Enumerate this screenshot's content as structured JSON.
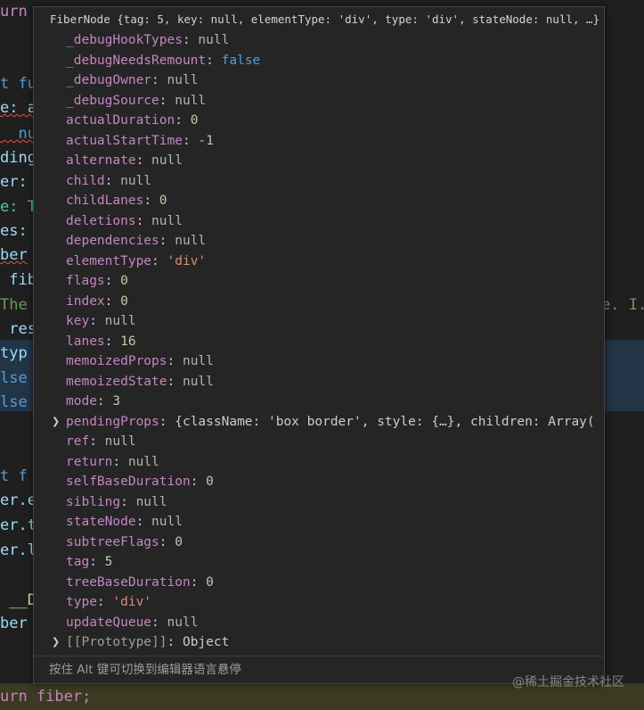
{
  "editor": {
    "lines": [
      {
        "text": "urn",
        "color": "#c586c0"
      },
      {
        "text": "t fu",
        "color": "#569cd6"
      },
      {
        "text": "e: a",
        "color": "#9cdcfe"
      },
      {
        "text": "  nu",
        "color": "#569cd6"
      },
      {
        "text": "ding",
        "color": "#9cdcfe"
      },
      {
        "text": "er:",
        "color": "#9cdcfe"
      },
      {
        "text": "e: T",
        "color": "#4ec9b0"
      },
      {
        "text": "es:",
        "color": "#9cdcfe"
      },
      {
        "text": "ber",
        "color": "#9cdcfe"
      },
      {
        "text": " fib",
        "color": "#9cdcfe"
      },
      {
        "text": "The",
        "color": "#6a9955"
      },
      {
        "text": " res",
        "color": "#9cdcfe"
      },
      {
        "text": "typ",
        "color": "#9cdcfe"
      },
      {
        "text": "lse",
        "color": "#569cd6"
      },
      {
        "text": "lse",
        "color": "#569cd6"
      },
      {
        "text": "t f",
        "color": "#569cd6"
      },
      {
        "text": "er.e",
        "color": "#9cdcfe"
      },
      {
        "text": "er.t",
        "color": "#9cdcfe"
      },
      {
        "text": "er.l",
        "color": "#9cdcfe"
      },
      {
        "text": " __D",
        "color": "#dcdcaa"
      },
      {
        "text": "ber",
        "color": "#9cdcfe"
      },
      {
        "text": "urn fiber;",
        "color": "#c586c0"
      }
    ],
    "right_fragment": "e. I."
  },
  "hover": {
    "title": "FiberNode {tag: 5, key: null, elementType: 'div', type: 'div', stateNode: null, …}",
    "properties": [
      {
        "key": "_debugHookTypes",
        "value": "null",
        "kind": "null"
      },
      {
        "key": "_debugNeedsRemount",
        "value": "false",
        "kind": "bool"
      },
      {
        "key": "_debugOwner",
        "value": "null",
        "kind": "null"
      },
      {
        "key": "_debugSource",
        "value": "null",
        "kind": "null"
      },
      {
        "key": "actualDuration",
        "value": "0",
        "kind": "num"
      },
      {
        "key": "actualStartTime",
        "value": "-1",
        "kind": "num"
      },
      {
        "key": "alternate",
        "value": "null",
        "kind": "null"
      },
      {
        "key": "child",
        "value": "null",
        "kind": "null"
      },
      {
        "key": "childLanes",
        "value": "0",
        "kind": "num"
      },
      {
        "key": "deletions",
        "value": "null",
        "kind": "null"
      },
      {
        "key": "dependencies",
        "value": "null",
        "kind": "null"
      },
      {
        "key": "elementType",
        "value": "'div'",
        "kind": "str"
      },
      {
        "key": "flags",
        "value": "0",
        "kind": "num"
      },
      {
        "key": "index",
        "value": "0",
        "kind": "num"
      },
      {
        "key": "key",
        "value": "null",
        "kind": "null"
      },
      {
        "key": "lanes",
        "value": "16",
        "kind": "num"
      },
      {
        "key": "memoizedProps",
        "value": "null",
        "kind": "null"
      },
      {
        "key": "memoizedState",
        "value": "null",
        "kind": "null"
      },
      {
        "key": "mode",
        "value": "3",
        "kind": "num"
      },
      {
        "key": "pendingProps",
        "value": "{className: 'box border', style: {…}, children: Array(",
        "kind": "obj",
        "expandable": true
      },
      {
        "key": "ref",
        "value": "null",
        "kind": "null"
      },
      {
        "key": "return",
        "value": "null",
        "kind": "null"
      },
      {
        "key": "selfBaseDuration",
        "value": "0",
        "kind": "num"
      },
      {
        "key": "sibling",
        "value": "null",
        "kind": "null"
      },
      {
        "key": "stateNode",
        "value": "null",
        "kind": "null"
      },
      {
        "key": "subtreeFlags",
        "value": "0",
        "kind": "num"
      },
      {
        "key": "tag",
        "value": "5",
        "kind": "num"
      },
      {
        "key": "treeBaseDuration",
        "value": "0",
        "kind": "num"
      },
      {
        "key": "type",
        "value": "'div'",
        "kind": "str"
      },
      {
        "key": "updateQueue",
        "value": "null",
        "kind": "null"
      },
      {
        "key": "[[Prototype]]",
        "value": "Object",
        "kind": "proto",
        "expandable": true
      }
    ],
    "footer": "按住 Alt 键可切换到编辑器语言悬停",
    "expand_icon": "chevron-right-icon"
  },
  "watermark": "@稀土掘金技术社区"
}
